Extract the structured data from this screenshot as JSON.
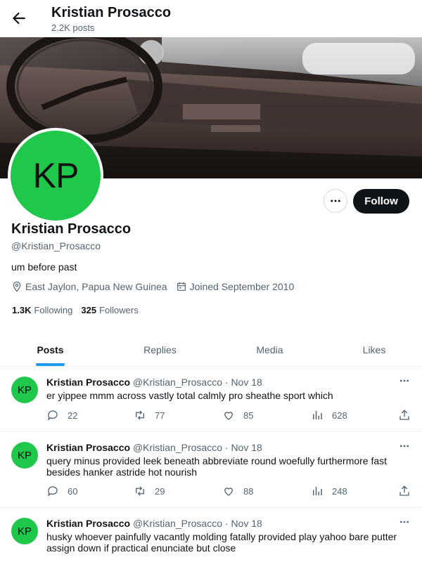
{
  "header": {
    "title": "Kristian Prosacco",
    "posts_count": "2.2K posts"
  },
  "profile": {
    "avatar_initials": "KP",
    "avatar_color": "#1fc84a",
    "name": "Kristian Prosacco",
    "handle": "@Kristian_Prosacco",
    "bio": "um before past",
    "location": "East Jaylon, Papua New Guinea",
    "joined": "Joined September 2010",
    "following_count": "1.3K",
    "following_label": "Following",
    "followers_count": "325",
    "followers_label": "Followers",
    "follow_label": "Follow"
  },
  "tabs": [
    {
      "label": "Posts",
      "active": true
    },
    {
      "label": "Replies",
      "active": false
    },
    {
      "label": "Media",
      "active": false
    },
    {
      "label": "Likes",
      "active": false
    }
  ],
  "posts": [
    {
      "name": "Kristian Prosacco",
      "handle": "@Kristian_Prosacco",
      "date": "· Nov 18",
      "text": "er yippee mmm across vastly total calmly pro sheathe sport which",
      "replies": "22",
      "reposts": "77",
      "likes": "85",
      "views": "628"
    },
    {
      "name": "Kristian Prosacco",
      "handle": "@Kristian_Prosacco",
      "date": "· Nov 18",
      "text": "query minus provided leek beneath abbreviate round woefully furthermore fast besides hanker astride hot nourish",
      "replies": "60",
      "reposts": "29",
      "likes": "88",
      "views": "248"
    },
    {
      "name": "Kristian Prosacco",
      "handle": "@Kristian_Prosacco",
      "date": "· Nov 18",
      "text": "husky whoever painfully vacantly molding fatally provided play yahoo bare putter assign down if practical enunciate but close",
      "replies": "",
      "reposts": "",
      "likes": "",
      "views": ""
    }
  ],
  "colors": {
    "accent": "#1d9bf0",
    "text": "#0f1419",
    "muted": "#536471",
    "follow_bg": "#0f1419"
  }
}
